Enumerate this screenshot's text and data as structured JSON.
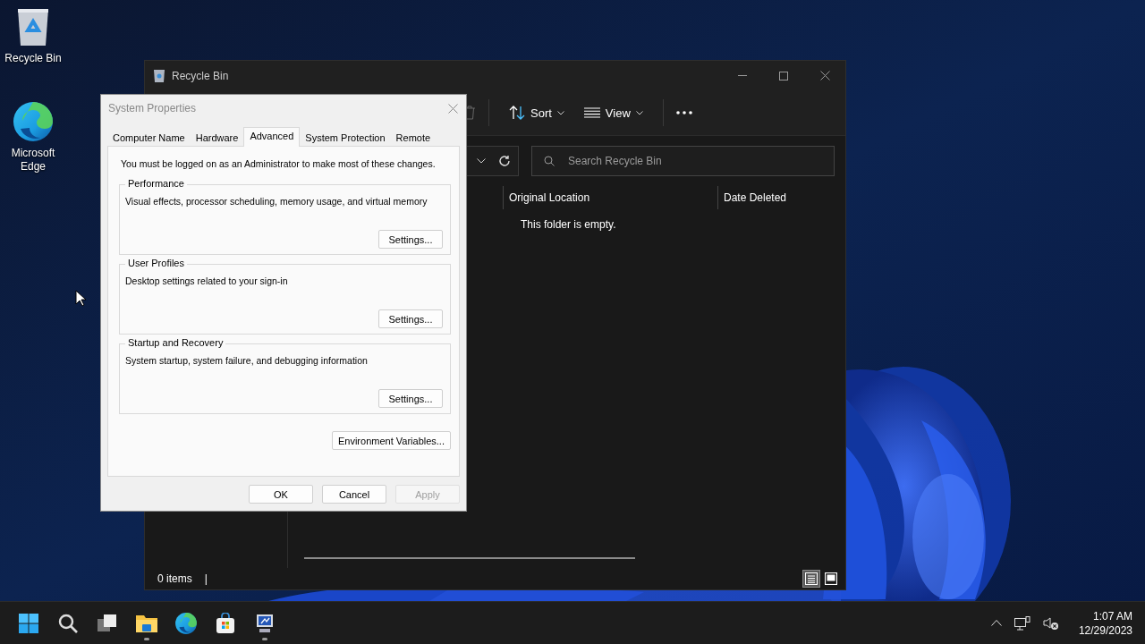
{
  "desktop_icons": [
    {
      "kind": "recycle",
      "label": "Recycle Bin"
    },
    {
      "kind": "edge",
      "label": "Microsoft Edge"
    }
  ],
  "explorer": {
    "title": "Recycle Bin",
    "toolbar": [
      {
        "kind": "sort",
        "label": "Sort"
      },
      {
        "kind": "view",
        "label": "View"
      }
    ],
    "search": {
      "placeholder": "Search Recycle Bin"
    },
    "columns": [
      "Original Location",
      "Date Deleted"
    ],
    "empty_message": "This folder is empty.",
    "status": "0 items",
    "status_separator": "|",
    "view_buttons": [
      {
        "kind": "details",
        "selected": true
      },
      {
        "kind": "tiles",
        "selected": false
      }
    ]
  },
  "dialog": {
    "title": "System Properties",
    "tabs": [
      {
        "label": "Computer Name",
        "selected": false
      },
      {
        "label": "Hardware",
        "selected": false
      },
      {
        "label": "Advanced",
        "selected": true
      },
      {
        "label": "System Protection",
        "selected": false
      },
      {
        "label": "Remote",
        "selected": false
      }
    ],
    "note": "You must be logged on as an Administrator to make most of these changes.",
    "groups": [
      {
        "title": "Performance",
        "description": "Visual effects, processor scheduling, memory usage, and virtual memory",
        "button": "Settings..."
      },
      {
        "title": "User Profiles",
        "description": "Desktop settings related to your sign-in",
        "button": "Settings..."
      },
      {
        "title": "Startup and Recovery",
        "description": "System startup, system failure, and debugging information",
        "button": "Settings..."
      }
    ],
    "env_button": "Environment Variables...",
    "buttons": [
      {
        "label": "OK",
        "disabled": false
      },
      {
        "label": "Cancel",
        "disabled": false
      },
      {
        "label": "Apply",
        "disabled": true
      }
    ]
  },
  "taskbar": {
    "apps": [
      {
        "kind": "start",
        "running": false
      },
      {
        "kind": "search",
        "running": false
      },
      {
        "kind": "taskview",
        "running": false
      },
      {
        "kind": "explorer",
        "running": true
      },
      {
        "kind": "edge",
        "running": false
      },
      {
        "kind": "store",
        "running": false
      },
      {
        "kind": "sysprops",
        "running": true
      }
    ],
    "time": "1:07 AM",
    "date": "12/29/2023"
  }
}
